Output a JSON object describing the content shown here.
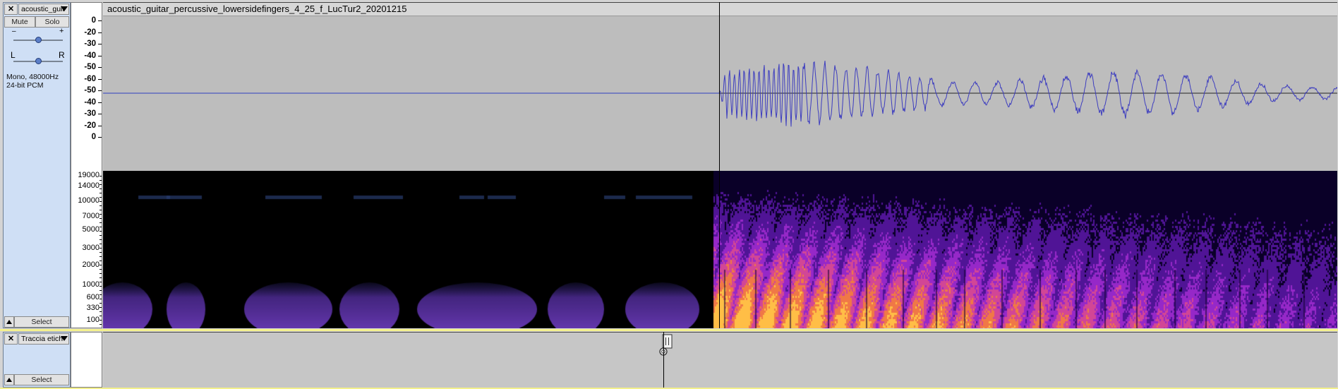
{
  "audio_track": {
    "close_glyph": "✕",
    "name": "acoustic_guit",
    "mute_label": "Mute",
    "solo_label": "Solo",
    "gain_minus": "–",
    "gain_plus": "+",
    "pan_left": "L",
    "pan_right": "R",
    "format_line1": "Mono, 48000Hz",
    "format_line2": "24-bit PCM",
    "select_label": "Select",
    "gain_level": 0.5,
    "pan_level": 0.5
  },
  "clip": {
    "title": "acoustic_guitar_percussive_lowersidefingers_4_25_f_LucTur2_20201215"
  },
  "waveform_ruler": [
    "0",
    "-20",
    "-30",
    "-40",
    "-50",
    "-60",
    "-50",
    "-40",
    "-30",
    "-20",
    "0"
  ],
  "spectrogram_ruler": [
    "19000",
    "14000",
    "10000",
    "7000",
    "5000",
    "3000",
    "2000",
    "1000",
    "600",
    "330",
    "100"
  ],
  "label_track": {
    "close_glyph": "✕",
    "name": "Traccia etich",
    "select_label": "Select"
  },
  "colors": {
    "waveform": "#3d3dbf",
    "centerline": "#2f3fc0",
    "panel": "#cfdff5",
    "selected_edge": "#f3f08c"
  },
  "icons": {
    "close": "close-icon",
    "dropdown": "chevron-down-icon",
    "collapse": "collapse-up-icon",
    "label_handle": "label-handle-icon"
  }
}
